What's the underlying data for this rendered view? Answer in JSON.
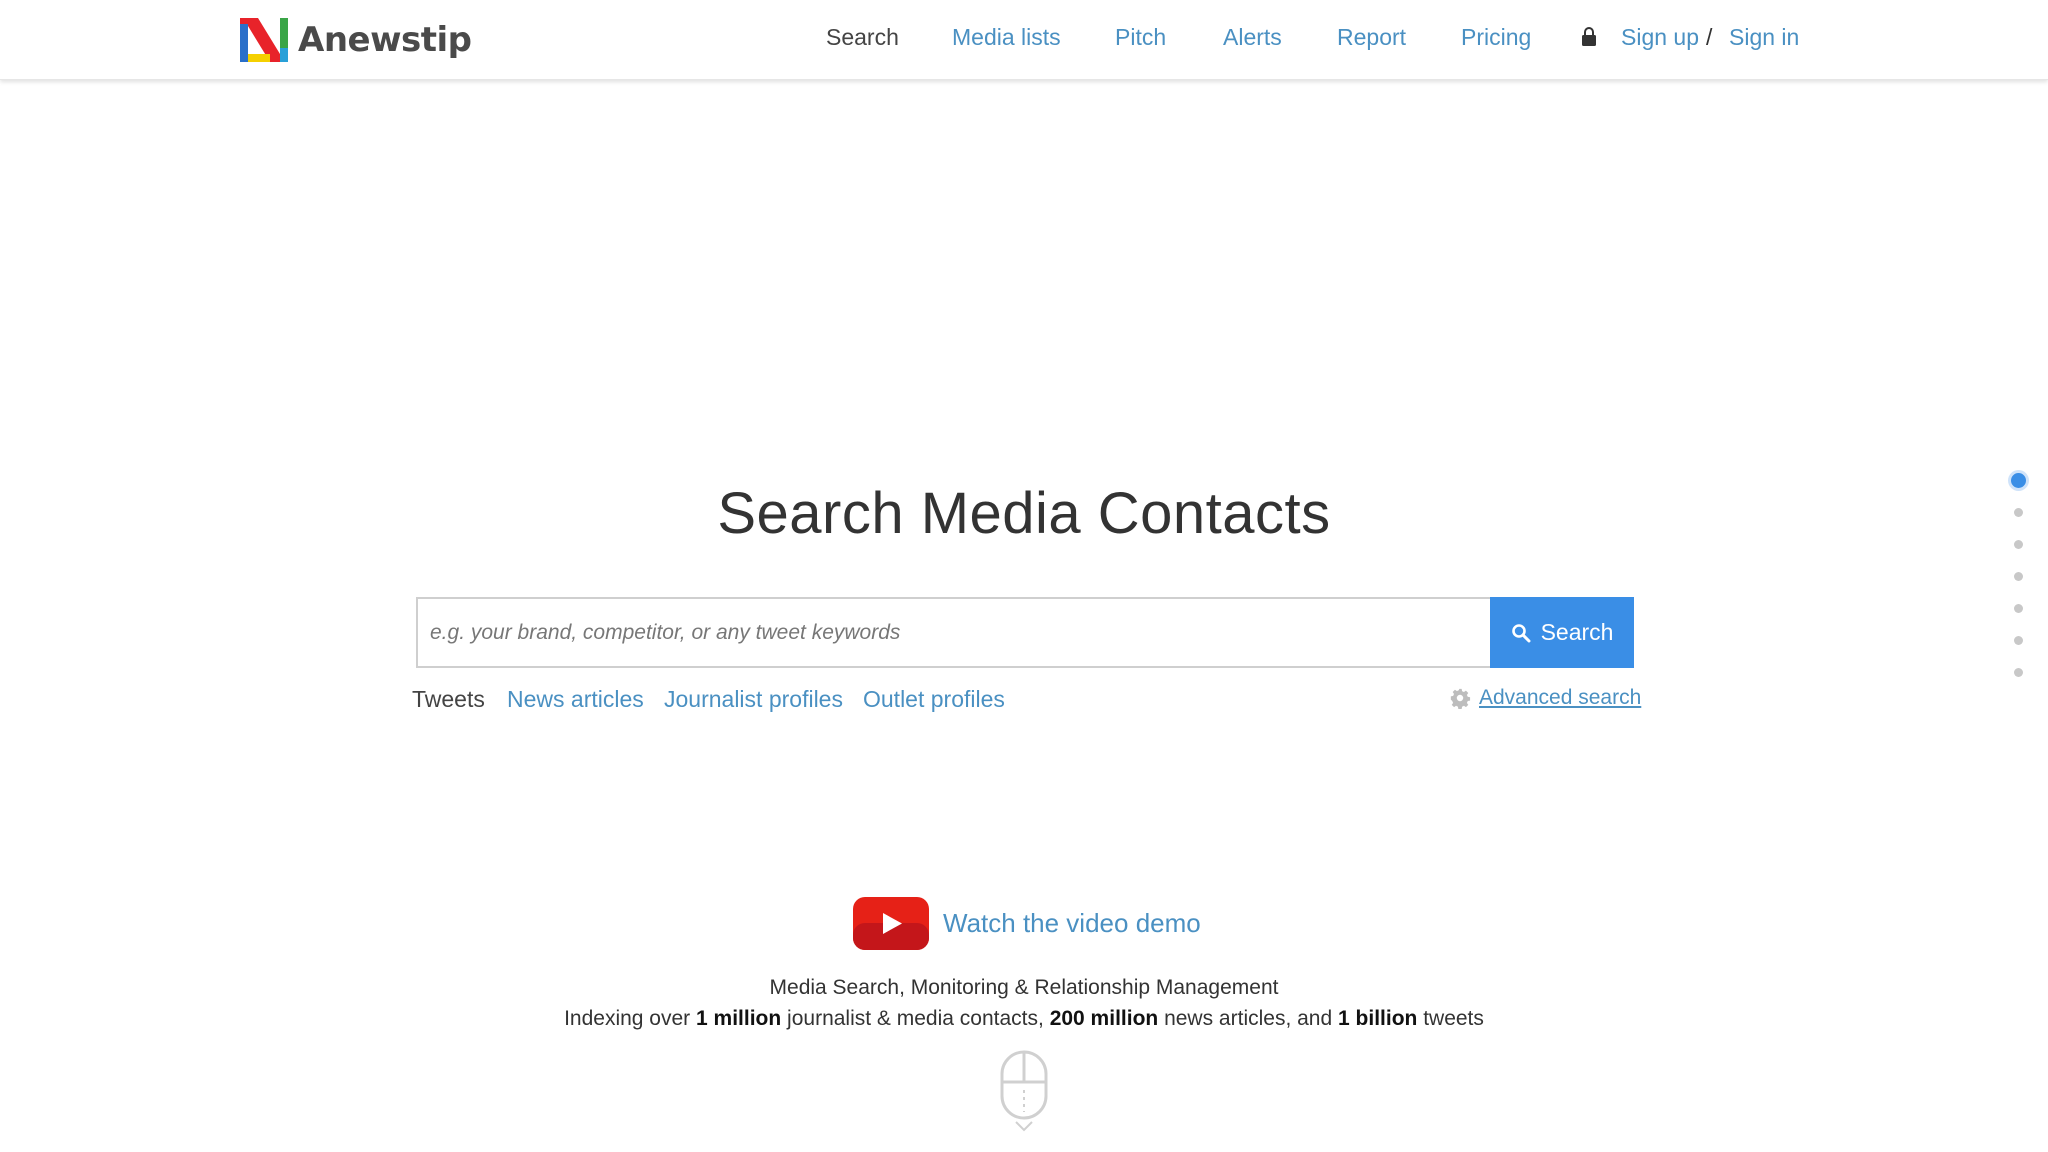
{
  "brand": {
    "name": "Anewstip"
  },
  "nav": {
    "items": [
      "Search",
      "Media lists",
      "Pitch",
      "Alerts",
      "Report",
      "Pricing"
    ],
    "active": "Search",
    "sign_up": "Sign up",
    "separator": "/",
    "sign_in": "Sign in"
  },
  "hero": {
    "title": "Search Media Contacts",
    "search_placeholder": "e.g. your brand, competitor, or any tweet keywords",
    "search_button": "Search",
    "filters": [
      "Tweets",
      "News articles",
      "Journalist profiles",
      "Outlet profiles"
    ],
    "active_filter": "Tweets",
    "advanced_search": "Advanced search"
  },
  "video": {
    "label": "Watch the video demo"
  },
  "tagline": "Media Search, Monitoring & Relationship Management",
  "stats": {
    "prefix": "Indexing over",
    "n1": "1 million",
    "t1": "journalist & media contacts,",
    "n2": "200 million",
    "t2": "news articles, and",
    "n3": "1 billion",
    "t3": "tweets"
  },
  "side_nav": {
    "count": 7,
    "active_index": 0
  },
  "colors": {
    "accent": "#3a8ee6",
    "link": "#4a90c2",
    "text": "#333333",
    "youtube": "#e62117"
  },
  "icons": [
    "lock-icon",
    "search-icon",
    "gear-icon",
    "youtube-play-icon",
    "mouse-scroll-icon"
  ]
}
